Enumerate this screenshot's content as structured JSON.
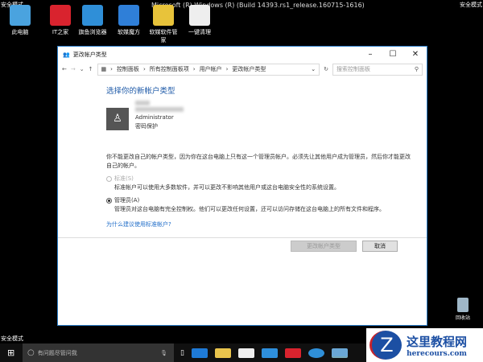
{
  "desktop": {
    "safe_mode": "安全模式",
    "build": "Microsoft (R) Windows (R) (Build 14393.rs1_release.160715-1616)",
    "icons": [
      {
        "label": "此电脑",
        "color": "#4aa3df"
      },
      {
        "label": "IT之家",
        "color": "#d9232e"
      },
      {
        "label": "旗鱼浏览器",
        "color": "#2f8fd8"
      },
      {
        "label": "软媒魔方",
        "color": "#2f7fd8"
      },
      {
        "label": "软媒软件管家",
        "color": "#e8c33a"
      },
      {
        "label": "一键清理",
        "color": "#eeeeee"
      }
    ],
    "recycle_bin": "回收站"
  },
  "window": {
    "title": "更改帐户类型",
    "breadcrumb": [
      "控制面板",
      "所有控制面板项",
      "用户帐户",
      "更改帐户类型"
    ],
    "search_placeholder": "搜索控制面板",
    "heading": "选择你的新帐户类型",
    "account_type": "Administrator",
    "password_status": "密码保护",
    "notice": "你不能更改自己的帐户类型，因为你在这台电脑上只有这一个管理员帐户。必须先让其他用户成为管理员，然后你才能更改自己的帐户。",
    "options": [
      {
        "label": "标准(S)",
        "desc": "标准帐户可以使用大多数软件，并可以更改不影响其他用户或这台电脑安全性的系统设置。",
        "selected": false,
        "disabled": true
      },
      {
        "label": "管理员(A)",
        "desc": "管理员对这台电脑有完全控制权。他们可以更改任何设置，还可以访问存储在这台电脑上的所有文件和程序。",
        "selected": true,
        "disabled": false
      }
    ],
    "help_link": "为什么建议使用标准帐户?",
    "change_button": "更改帐户类型",
    "cancel_button": "取消"
  },
  "taskbar": {
    "search_placeholder": "有问题尽管问我"
  },
  "watermark": {
    "title": "这里教程网",
    "url": "herecours.com"
  }
}
